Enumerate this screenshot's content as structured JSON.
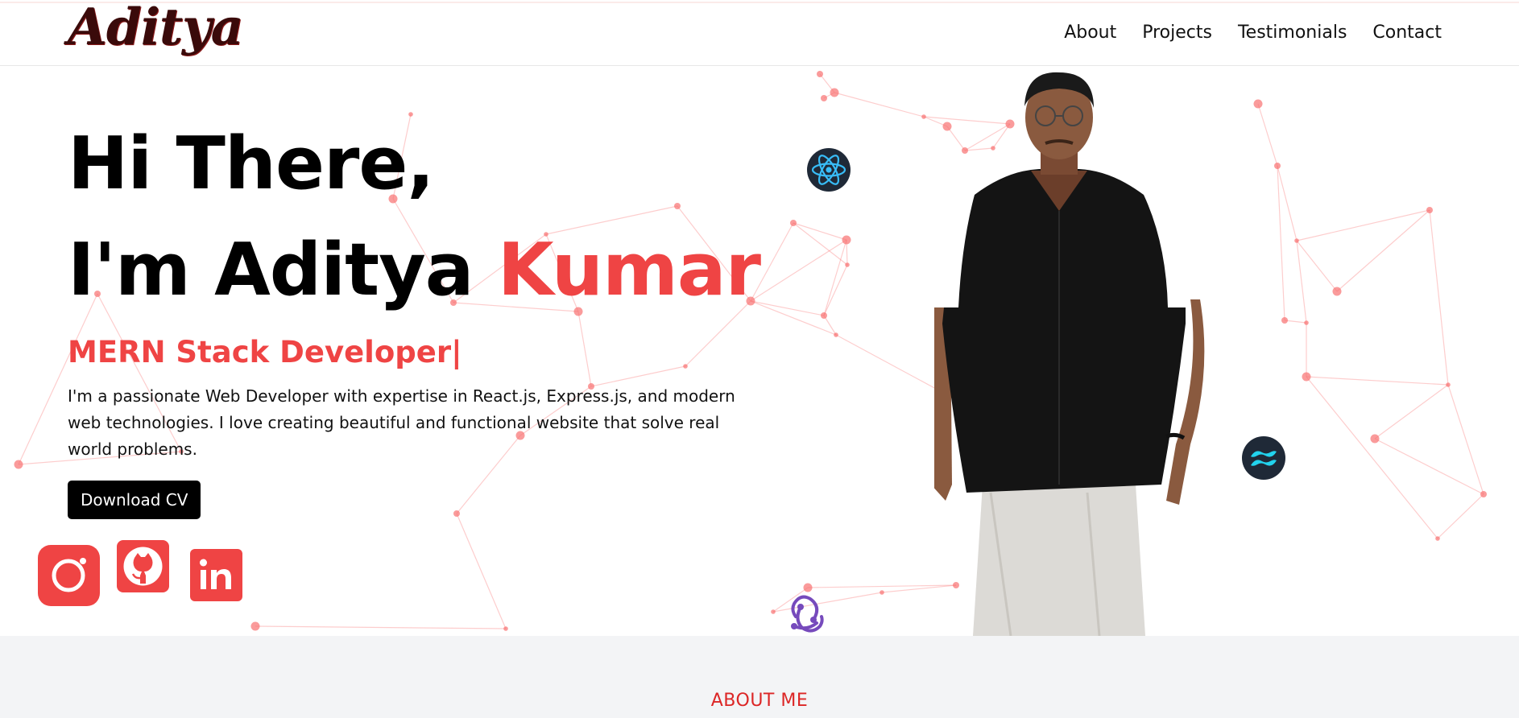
{
  "header": {
    "logo_text": "Aditya",
    "nav": [
      {
        "label": "About"
      },
      {
        "label": "Projects"
      },
      {
        "label": "Testimonials"
      },
      {
        "label": "Contact"
      }
    ]
  },
  "hero": {
    "greeting": "Hi There,",
    "name_prefix": "I'm Aditya ",
    "name_highlight": "Kumar",
    "role": "MERN Stack Developer|",
    "bio": "I'm a passionate Web Developer with expertise in React.js, Express.js, and modern web technologies. I love creating beautiful and functional website that solve real world problems.",
    "cv_button": "Download CV"
  },
  "social": [
    {
      "icon": "instagram-icon"
    },
    {
      "icon": "github-icon"
    },
    {
      "icon": "linkedin-icon"
    }
  ],
  "tech_icons": [
    "react-icon",
    "tailwind-icon",
    "redux-icon"
  ],
  "about": {
    "title": "ABOUT ME"
  },
  "colors": {
    "accent": "#ef4444",
    "button_bg": "#000000",
    "about_bg": "#f3f4f6",
    "network": "#f87171"
  }
}
